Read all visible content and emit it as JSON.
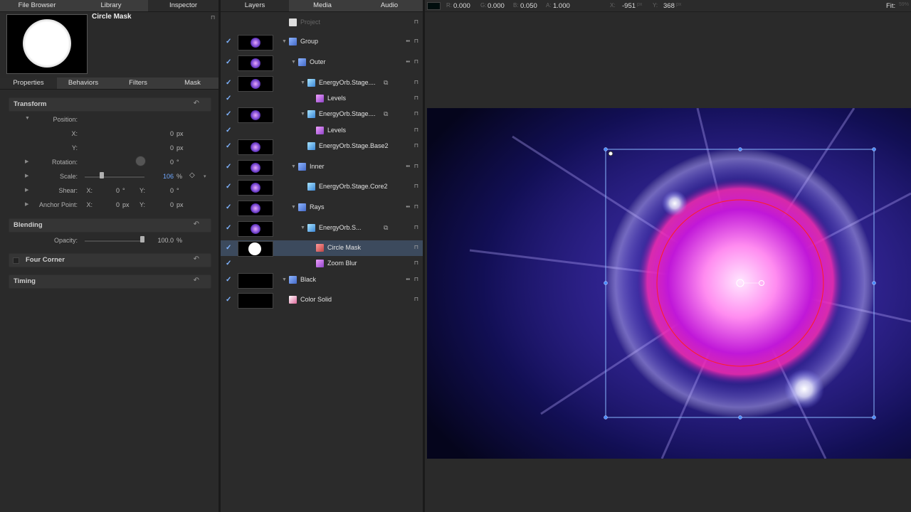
{
  "left_tabs": [
    "File Browser",
    "Library",
    "Inspector"
  ],
  "inspector": {
    "title": "Circle Mask",
    "subtabs": [
      "Properties",
      "Behaviors",
      "Filters",
      "Mask"
    ],
    "sections": {
      "transform": "Transform",
      "blending": "Blending",
      "four_corner": "Four Corner",
      "timing": "Timing"
    },
    "position": {
      "label": "Position:",
      "x_label": "X:",
      "x": "0",
      "y_label": "Y:",
      "y": "0",
      "unit": "px"
    },
    "rotation": {
      "label": "Rotation:",
      "value": "0",
      "unit": "°"
    },
    "scale": {
      "label": "Scale:",
      "value": "106",
      "unit": "%"
    },
    "shear": {
      "label": "Shear:",
      "x_label": "X:",
      "x": "0",
      "x_unit": "°",
      "y_label": "Y:",
      "y": "0",
      "y_unit": "°"
    },
    "anchor": {
      "label": "Anchor Point:",
      "x_label": "X:",
      "x": "0",
      "x_unit": "px",
      "y_label": "Y:",
      "y": "0",
      "y_unit": "px"
    },
    "opacity": {
      "label": "Opacity:",
      "value": "100.0",
      "unit": "%"
    }
  },
  "layers_tabs": [
    "Layers",
    "Media",
    "Audio"
  ],
  "layers": [
    {
      "name": "Project",
      "icon": "project-icon",
      "checked": false,
      "dim": true
    },
    {
      "name": "Group",
      "icon": "group-icon",
      "checked": true
    },
    {
      "name": "Outer",
      "icon": "group-icon",
      "checked": true
    },
    {
      "name": "EnergyOrb.Stage....",
      "icon": "image-icon",
      "checked": true
    },
    {
      "name": "Levels",
      "icon": "filter-icon",
      "checked": true
    },
    {
      "name": "EnergyOrb.Stage....",
      "icon": "image-icon",
      "checked": true
    },
    {
      "name": "Levels",
      "icon": "filter-icon",
      "checked": true
    },
    {
      "name": "EnergyOrb.Stage.Base2",
      "icon": "image-icon",
      "checked": true
    },
    {
      "name": "Inner",
      "icon": "group-icon",
      "checked": true
    },
    {
      "name": "EnergyOrb.Stage.Core2",
      "icon": "image-icon",
      "checked": true
    },
    {
      "name": "Rays",
      "icon": "group-icon",
      "checked": true
    },
    {
      "name": "EnergyOrb.S...",
      "icon": "image-icon",
      "checked": true
    },
    {
      "name": "Circle Mask",
      "icon": "mask-icon",
      "checked": true,
      "selected": true
    },
    {
      "name": "Zoom Blur",
      "icon": "filter-icon",
      "checked": true
    },
    {
      "name": "Black",
      "icon": "group-icon",
      "checked": true
    },
    {
      "name": "Color Solid",
      "icon": "solid-icon",
      "checked": true
    }
  ],
  "hud": {
    "r_label": "R:",
    "r": "0.000",
    "g_label": "G:",
    "g": "0.000",
    "b_label": "B:",
    "b": "0.050",
    "a_label": "A:",
    "a": "1.000",
    "x_label": "X:",
    "x": "-951",
    "x_unit": "px",
    "y_label": "Y:",
    "y": "368",
    "y_unit": "px",
    "fit": "Fit:",
    "fit_value": "59%"
  },
  "colors": {
    "accent": "#7fb3ff",
    "selection": "#3c4a5d",
    "mask_circle": "#ff2020",
    "transform_box": "#8ab8ff"
  }
}
